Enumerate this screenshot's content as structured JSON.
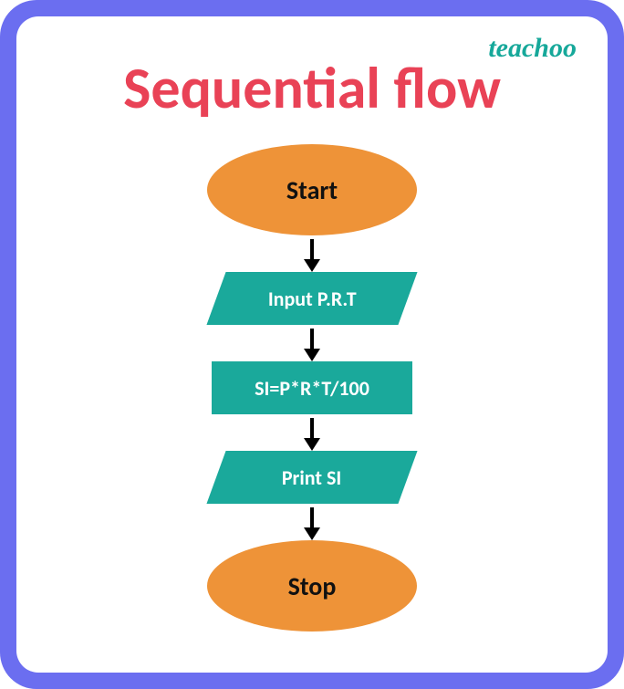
{
  "brand": "teachoo",
  "title": "Sequential flow",
  "flowchart": {
    "start": "Start",
    "input": "Input P.R.T",
    "process": "SI=P*R*T/100",
    "output": "Print SI",
    "stop": "Stop"
  }
}
